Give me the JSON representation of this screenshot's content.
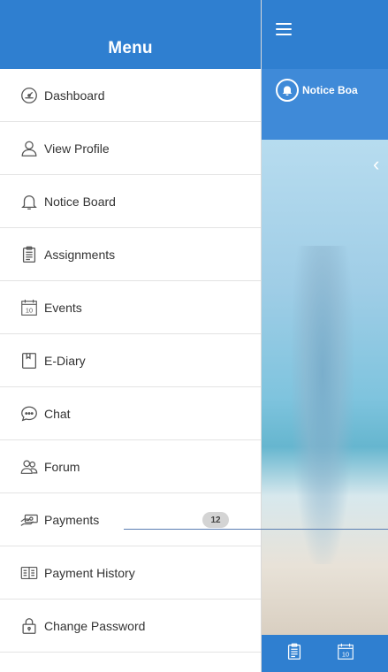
{
  "drawer": {
    "title": "Menu",
    "items": [
      {
        "label": "Dashboard",
        "icon": "dashboard-icon"
      },
      {
        "label": "View Profile",
        "icon": "user-icon"
      },
      {
        "label": "Notice Board",
        "icon": "bell-icon"
      },
      {
        "label": "Assignments",
        "icon": "clipboard-icon"
      },
      {
        "label": "Events",
        "icon": "calendar-icon"
      },
      {
        "label": "E-Diary",
        "icon": "diary-icon"
      },
      {
        "label": "Chat",
        "icon": "chat-icon"
      },
      {
        "label": "Forum",
        "icon": "forum-icon"
      },
      {
        "label": "Payments",
        "icon": "payments-icon",
        "badge": "12"
      },
      {
        "label": "Payment History",
        "icon": "payment-history-icon"
      },
      {
        "label": "Change Password",
        "icon": "lock-icon"
      }
    ]
  },
  "main": {
    "notice_title": "Notice Boa"
  },
  "calendar_day": "10",
  "colors": {
    "primary": "#2f7fd0",
    "primary_light": "#3f8ad8",
    "divider": "#e3e3e3",
    "text": "#333333"
  }
}
